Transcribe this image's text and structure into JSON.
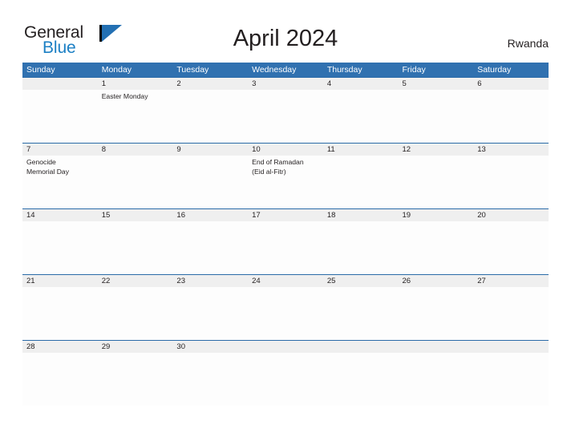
{
  "brand": {
    "name_part1": "General",
    "name_part2": "Blue",
    "mark_icon": "triangle-flag-icon",
    "accent_color": "#2370b3",
    "blue_text_color": "#1b7fc4"
  },
  "header": {
    "title": "April 2024",
    "country": "Rwanda"
  },
  "calendar": {
    "header_color": "#3071b0",
    "date_band_color": "#efefef",
    "rule_color": "#2a6ba8",
    "weekdays": [
      "Sunday",
      "Monday",
      "Tuesday",
      "Wednesday",
      "Thursday",
      "Friday",
      "Saturday"
    ],
    "weeks": [
      {
        "dates": [
          "",
          "1",
          "2",
          "3",
          "4",
          "5",
          "6"
        ],
        "events": [
          [],
          [
            "Easter Monday"
          ],
          [],
          [],
          [],
          [],
          []
        ]
      },
      {
        "dates": [
          "7",
          "8",
          "9",
          "10",
          "11",
          "12",
          "13"
        ],
        "events": [
          [
            "Genocide",
            "Memorial Day"
          ],
          [],
          [],
          [
            "End of Ramadan",
            "(Eid al-Fitr)"
          ],
          [],
          [],
          []
        ]
      },
      {
        "dates": [
          "14",
          "15",
          "16",
          "17",
          "18",
          "19",
          "20"
        ],
        "events": [
          [],
          [],
          [],
          [],
          [],
          [],
          []
        ]
      },
      {
        "dates": [
          "21",
          "22",
          "23",
          "24",
          "25",
          "26",
          "27"
        ],
        "events": [
          [],
          [],
          [],
          [],
          [],
          [],
          []
        ]
      },
      {
        "dates": [
          "28",
          "29",
          "30",
          "",
          "",
          "",
          ""
        ],
        "events": [
          [],
          [],
          [],
          [],
          [],
          [],
          []
        ]
      }
    ]
  }
}
